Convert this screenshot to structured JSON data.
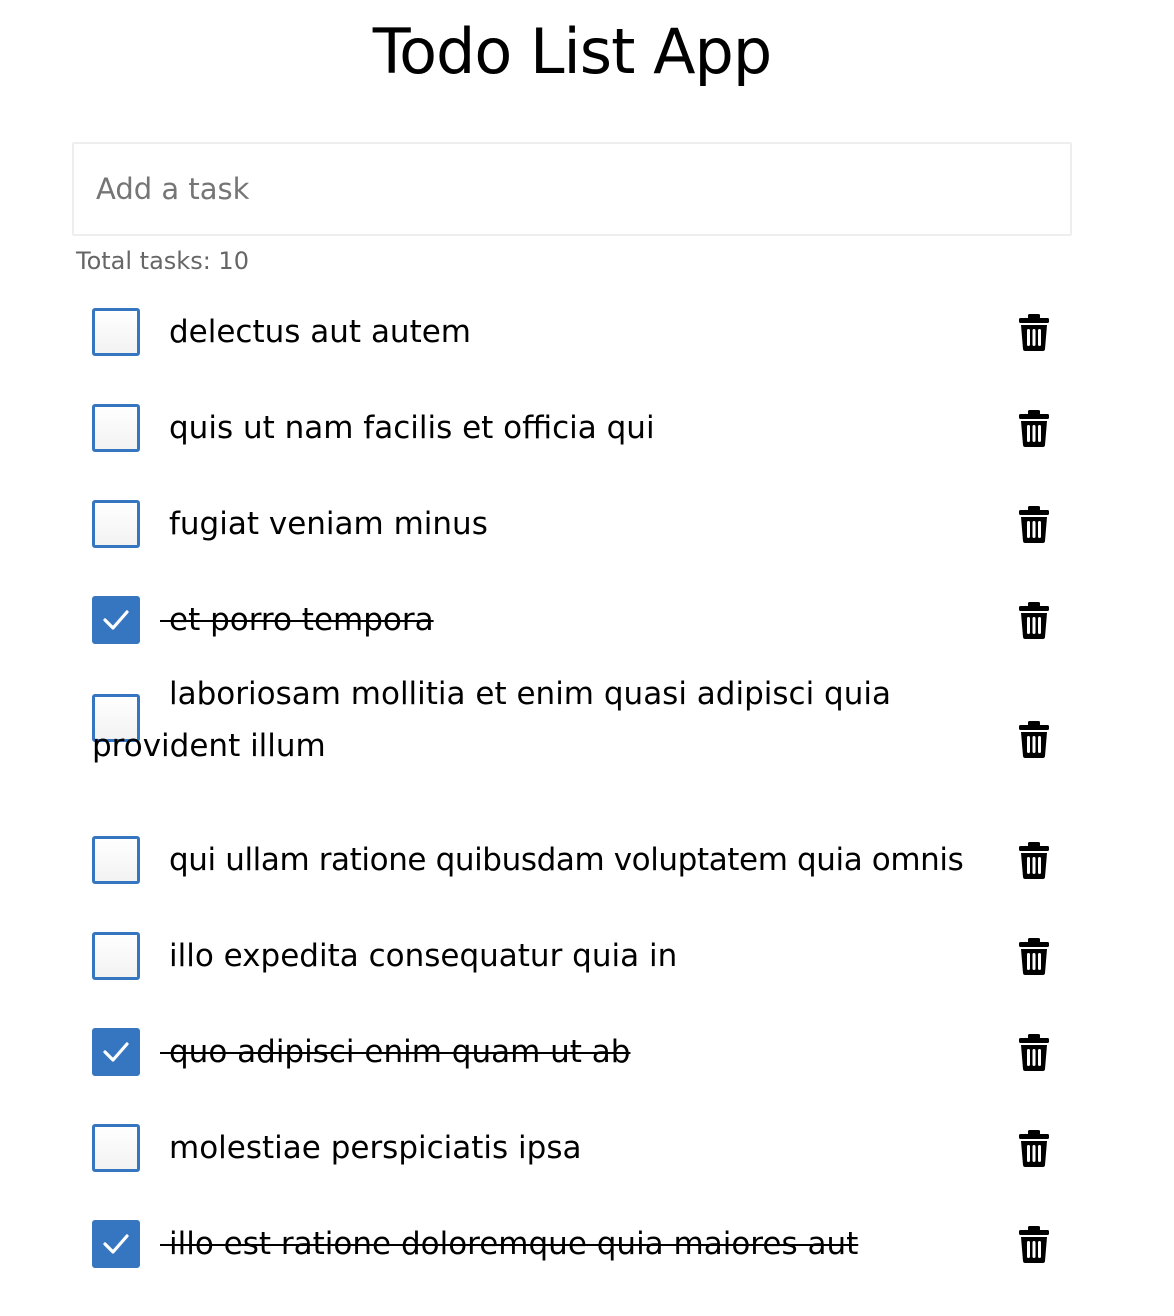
{
  "app": {
    "title": "Todo List App"
  },
  "input": {
    "placeholder": "Add a task",
    "value": ""
  },
  "summary": {
    "total_label": "Total tasks: 10"
  },
  "colors": {
    "accent": "#3676c0",
    "text": "#000000",
    "muted": "#666666"
  },
  "icons": {
    "delete": "trash-icon",
    "check": "checkmark-icon"
  },
  "tasks": [
    {
      "text": "delectus aut autem",
      "completed": false
    },
    {
      "text": "quis ut nam facilis et officia qui",
      "completed": false
    },
    {
      "text": "fugiat veniam minus",
      "completed": false
    },
    {
      "text": "et porro tempora",
      "completed": true
    },
    {
      "text": "laboriosam mollitia et enim quasi adipisci quia provident illum",
      "completed": false
    },
    {
      "text": "qui ullam ratione quibusdam voluptatem quia omnis",
      "completed": false
    },
    {
      "text": "illo expedita consequatur quia in",
      "completed": false
    },
    {
      "text": "quo adipisci enim quam ut ab",
      "completed": true
    },
    {
      "text": "molestiae perspiciatis ipsa",
      "completed": false
    },
    {
      "text": "illo est ratione doloremque quia maiores aut",
      "completed": true
    }
  ]
}
